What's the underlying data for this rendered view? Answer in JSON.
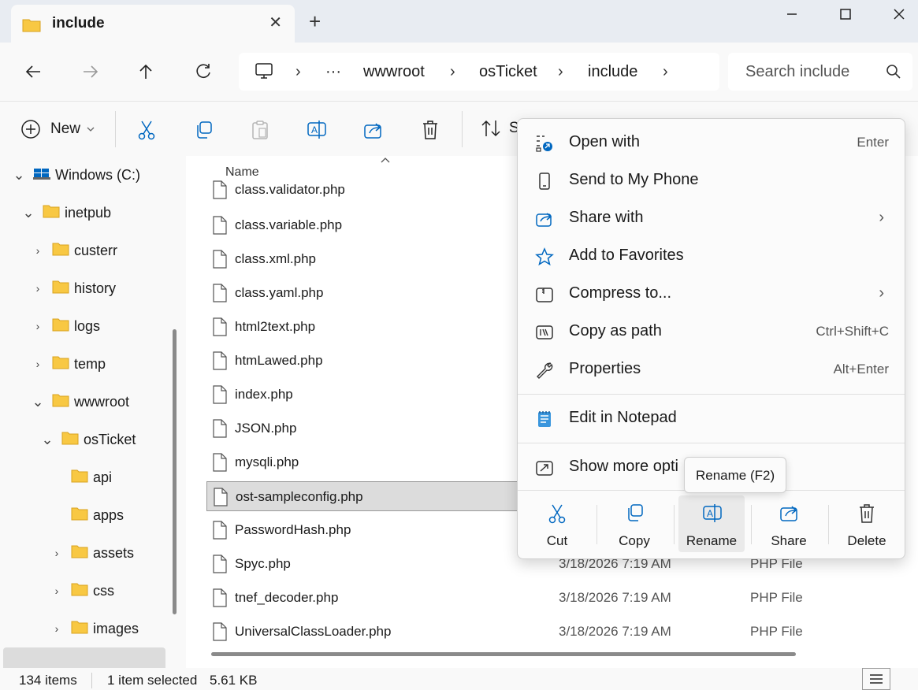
{
  "tab": {
    "title": "include",
    "close_glyph": "✕",
    "new_glyph": "+"
  },
  "address": {
    "overflow": "···",
    "crumbs": [
      "wwwroot",
      "osTicket",
      "include"
    ],
    "sep": "›"
  },
  "search": {
    "placeholder": "Search include"
  },
  "commandbar": {
    "new_label": "New",
    "sort_partial": "S"
  },
  "nav": {
    "items": [
      {
        "label": "Windows (C:)",
        "chev": "⌄"
      },
      {
        "label": "inetpub",
        "chev": "⌄"
      },
      {
        "label": "custerr",
        "chev": "›"
      },
      {
        "label": "history",
        "chev": "›"
      },
      {
        "label": "logs",
        "chev": "›"
      },
      {
        "label": "temp",
        "chev": "›"
      },
      {
        "label": "wwwroot",
        "chev": "⌄"
      },
      {
        "label": "osTicket",
        "chev": "⌄"
      },
      {
        "label": "api",
        "chev": ""
      },
      {
        "label": "apps",
        "chev": ""
      },
      {
        "label": "assets",
        "chev": "›"
      },
      {
        "label": "css",
        "chev": "›"
      },
      {
        "label": "images",
        "chev": "›"
      }
    ]
  },
  "list": {
    "name_header": "Name",
    "files": [
      {
        "name": "class.validator.php",
        "date": "",
        "type": ""
      },
      {
        "name": "class.variable.php",
        "date": "",
        "type": ""
      },
      {
        "name": "class.xml.php",
        "date": "",
        "type": ""
      },
      {
        "name": "class.yaml.php",
        "date": "",
        "type": ""
      },
      {
        "name": "html2text.php",
        "date": "",
        "type": ""
      },
      {
        "name": "htmLawed.php",
        "date": "",
        "type": ""
      },
      {
        "name": "index.php",
        "date": "",
        "type": ""
      },
      {
        "name": "JSON.php",
        "date": "",
        "type": ""
      },
      {
        "name": "mysqli.php",
        "date": "",
        "type": ""
      },
      {
        "name": "ost-sampleconfig.php",
        "date": "",
        "type": ""
      },
      {
        "name": "PasswordHash.php",
        "date": "",
        "type": ""
      },
      {
        "name": "Spyc.php",
        "date": "3/18/2026 7:19 AM",
        "type": "PHP File"
      },
      {
        "name": "tnef_decoder.php",
        "date": "3/18/2026 7:19 AM",
        "type": "PHP File"
      },
      {
        "name": "UniversalClassLoader.php",
        "date": "3/18/2026 7:19 AM",
        "type": "PHP File"
      }
    ]
  },
  "status": {
    "count": "134 items",
    "selected": "1 item selected",
    "size": "5.61 KB"
  },
  "menu": {
    "items": [
      {
        "label": "Open with",
        "shortcut": "Enter",
        "arrow": ""
      },
      {
        "label": "Send to My Phone",
        "shortcut": "",
        "arrow": ""
      },
      {
        "label": "Share with",
        "shortcut": "",
        "arrow": "›"
      },
      {
        "label": "Add to Favorites",
        "shortcut": "",
        "arrow": ""
      },
      {
        "label": "Compress to...",
        "shortcut": "",
        "arrow": "›"
      },
      {
        "label": "Copy as path",
        "shortcut": "Ctrl+Shift+C",
        "arrow": ""
      },
      {
        "label": "Properties",
        "shortcut": "Alt+Enter",
        "arrow": ""
      },
      {
        "label": "Edit in Notepad",
        "shortcut": "",
        "arrow": ""
      },
      {
        "label": "Show more opti",
        "shortcut": "",
        "arrow": ""
      }
    ],
    "quick": [
      "Cut",
      "Copy",
      "Rename",
      "Share",
      "Delete"
    ]
  },
  "tooltip": {
    "text": "Rename (F2)"
  },
  "colors": {
    "folder": "#f8c843",
    "accent": "#0067c0",
    "selection": "#dcdcdc"
  }
}
